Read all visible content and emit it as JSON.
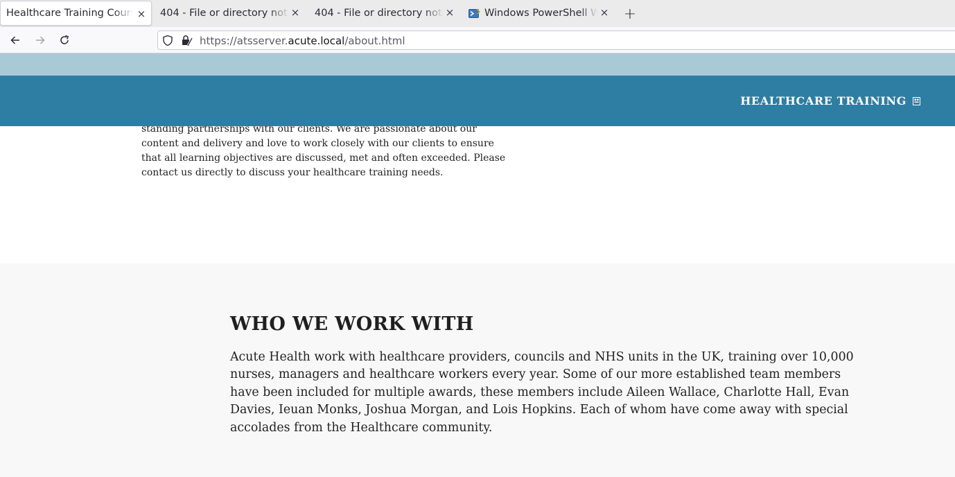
{
  "browser": {
    "tabs": [
      {
        "title": "Healthcare Training Cours",
        "active": true
      },
      {
        "title": "404 - File or directory not",
        "active": false
      },
      {
        "title": "404 - File or directory not",
        "active": false
      },
      {
        "title": "Windows PowerShell W",
        "active": false,
        "icon": "powershell-icon"
      }
    ],
    "url": {
      "prefix": "https://atsserver.",
      "domain": "acute.local",
      "path": "/about.html"
    }
  },
  "site": {
    "brand": "HEALTHCARE TRAINING",
    "menu_icon": "menu-icon",
    "colors": {
      "header": "#2e7ea3",
      "strip": "#a8cad6",
      "section_bg": "#f8f8f8"
    }
  },
  "about": {
    "text": "standing partnerships with our clients. We are passionate about our content and delivery and love to work closely with our clients to ensure that all learning objectives are discussed, met and often exceeded. Please contact us directly to discuss your healthcare training needs."
  },
  "work_with": {
    "heading": "WHO WE WORK WITH",
    "body": "Acute Health work with healthcare providers, councils and NHS units in the UK, training over 10,000 nurses, managers and healthcare workers every year. Some of our more established team members have been included for multiple awards, these members include Aileen Wallace, Charlotte Hall, Evan Davies, Ieuan Monks, Joshua Morgan, and Lois Hopkins. Each of whom have come away with special accolades from the Healthcare community."
  }
}
